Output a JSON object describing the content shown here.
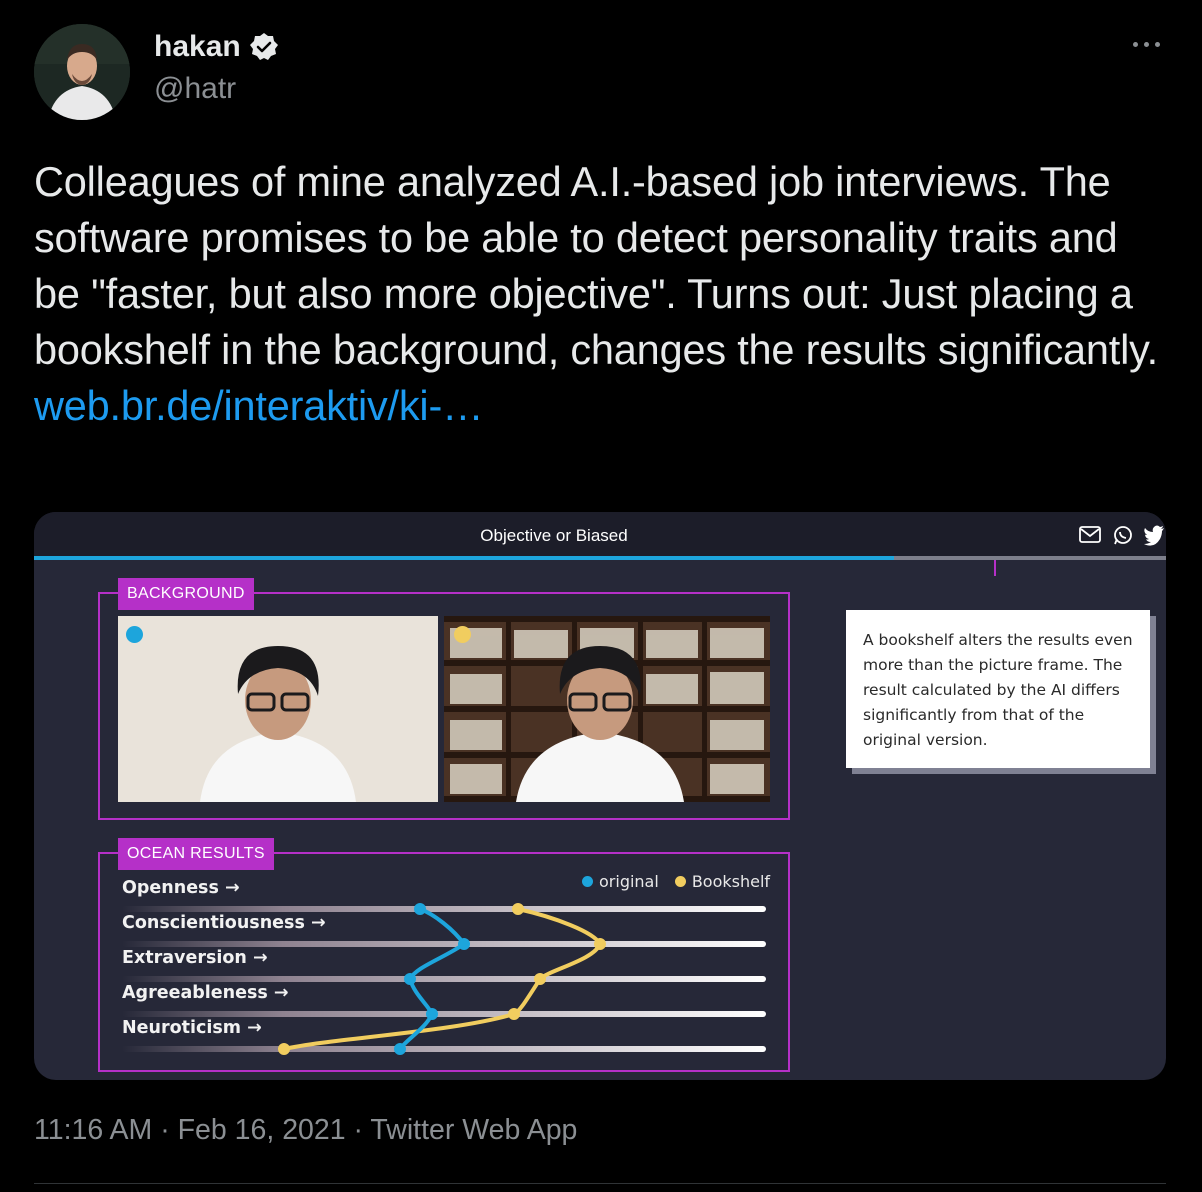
{
  "user": {
    "name": "hakan",
    "handle": "@hatr",
    "verified": true
  },
  "tweet": {
    "text": "Colleagues of mine analyzed A.I.-based job interviews. The software promises to be able to detect personality traits and be \"faster, but also more objective\". Turns out: Just placing a bookshelf in the background, changes the results significantly.",
    "link": "web.br.de/interaktiv/ki-…"
  },
  "card": {
    "title": "Objective or Biased",
    "background_label": "BACKGROUND",
    "ocean_label": "OCEAN RESULTS",
    "callout": "A bookshelf alters the results even more than the picture frame. The result calculated by the AI differs significantly from that of the original version.",
    "legend": {
      "original": "original",
      "bookshelf": "Bookshelf"
    },
    "traits": [
      "Openness →",
      "Conscientiousness →",
      "Extraversion →",
      "Agreeableness →",
      "Neuroticism →"
    ],
    "progress_fraction": 0.76,
    "colors": {
      "original": "#1da5dc",
      "bookshelf": "#f1cd5f",
      "accent": "#b530c8"
    }
  },
  "footer": {
    "time": "11:16 AM",
    "date": "Feb 16, 2021",
    "source": "Twitter Web App",
    "sep": " · "
  }
}
